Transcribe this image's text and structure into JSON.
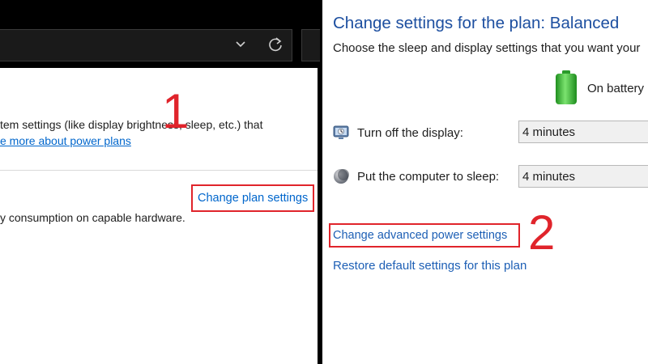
{
  "left_panel": {
    "description": "tem settings (like display brightness, sleep, etc.) that",
    "learn_link": "e more about power plans",
    "change_plan_link": "Change plan settings",
    "battery_text": "y consumption on capable hardware.",
    "step_number": "1",
    "icons": [
      "chevron-down-icon",
      "refresh-icon"
    ]
  },
  "right_panel": {
    "title": "Change settings for the plan: Balanced",
    "subtitle": "Choose the sleep and display settings that you want your",
    "battery_column": "On battery",
    "rows": [
      {
        "label": "Turn off the display:",
        "value": "4 minutes",
        "icon": "display-icon"
      },
      {
        "label": "Put the computer to sleep:",
        "value": "4 minutes",
        "icon": "sleep-moon-icon"
      }
    ],
    "advanced_link": "Change advanced power settings",
    "restore_link": "Restore default settings for this plan",
    "step_number": "2"
  },
  "colors": {
    "link": "#0066cc",
    "title": "#1d4fa0",
    "highlight": "#e0242b",
    "battery": "#3dbf3a"
  }
}
